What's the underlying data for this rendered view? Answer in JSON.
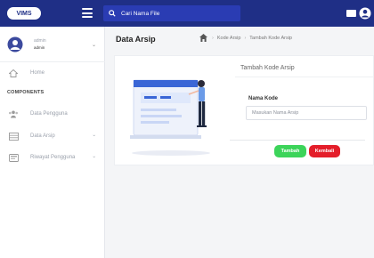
{
  "topbar": {
    "logo_text": "VIMS",
    "search_placeholder": "Cari Nama File",
    "colors": {
      "bar": "#1f2f86",
      "search": "#2a3cb3"
    }
  },
  "sidebar": {
    "profile": {
      "name": "admin",
      "role": "admin"
    },
    "home_label": "Home",
    "section_title": "COMPONENTS",
    "items": [
      {
        "label": "Data Pengguna",
        "icon": "users-icon"
      },
      {
        "label": "Data Arsip",
        "icon": "table-icon",
        "has_chevron": true
      },
      {
        "label": "Riwayat Pengguna",
        "icon": "history-icon",
        "has_chevron": true
      }
    ]
  },
  "main": {
    "page_title": "Data Arsip",
    "breadcrumb": [
      "Kode Arsip",
      "Tambah Kode Arsip"
    ],
    "form": {
      "title": "Tambah Kode Arsip",
      "field_label": "Nama Kode",
      "field_placeholder": "Masukan Nama Arsip",
      "field_value": "",
      "submit_label": "Tambah",
      "back_label": "Kembali"
    },
    "colors": {
      "submit": "#3cd45a",
      "back": "#e41e2a"
    }
  }
}
